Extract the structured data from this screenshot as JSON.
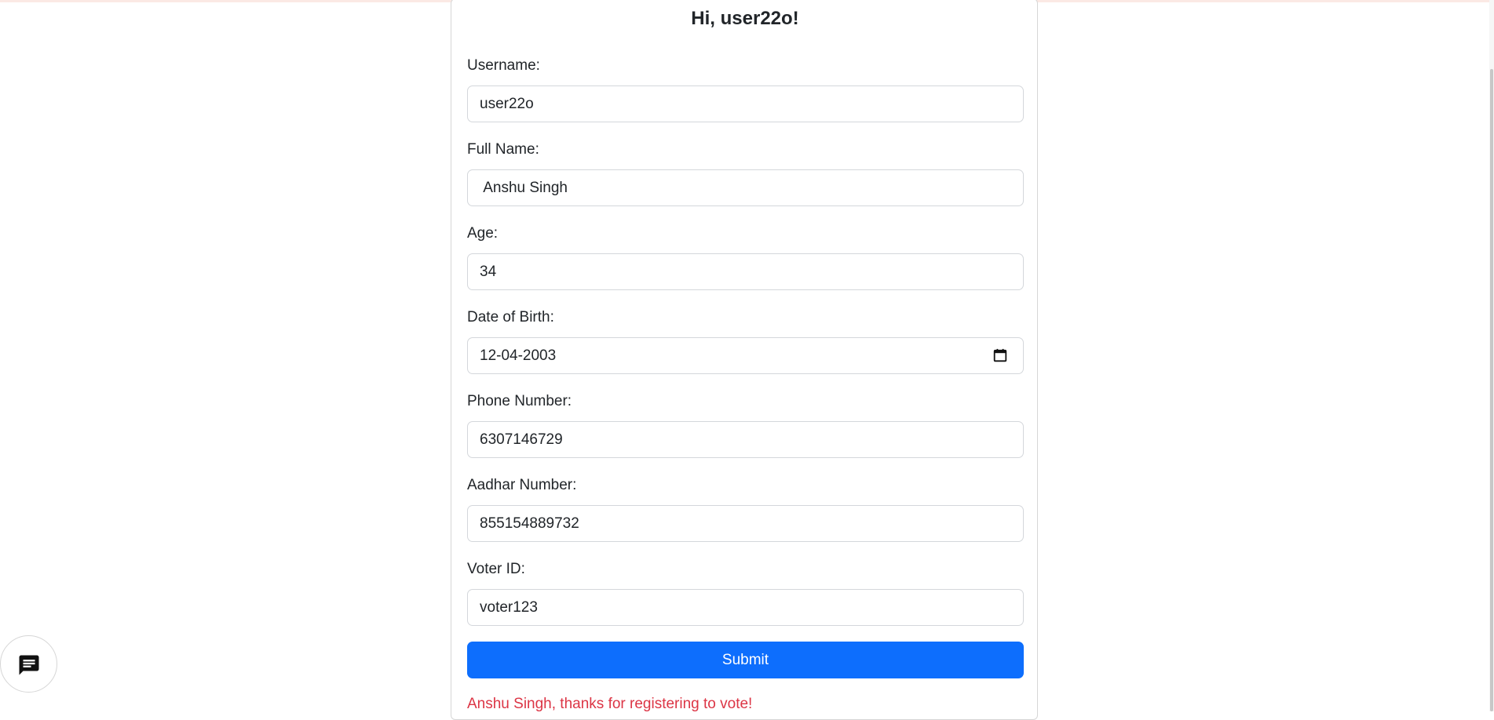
{
  "form": {
    "greeting": "Hi, user22o!",
    "fields": [
      {
        "label": "Username:",
        "value": "user22o"
      },
      {
        "label": "Full Name:",
        "value": " Anshu Singh"
      },
      {
        "label": "Age:",
        "value": "34"
      },
      {
        "label": "Date of Birth:",
        "value": "12-04-2003"
      },
      {
        "label": "Phone Number:",
        "value": "6307146729"
      },
      {
        "label": "Aadhar Number:",
        "value": "855154889732"
      },
      {
        "label": "Voter ID:",
        "value": "voter123"
      }
    ],
    "submit_label": "Submit",
    "message": "Anshu Singh, thanks for registering to vote!"
  },
  "colors": {
    "primary": "#0d6efd",
    "message": "#dc3545"
  },
  "icons": {
    "date": "calendar-icon",
    "chat": "chat-icon"
  }
}
